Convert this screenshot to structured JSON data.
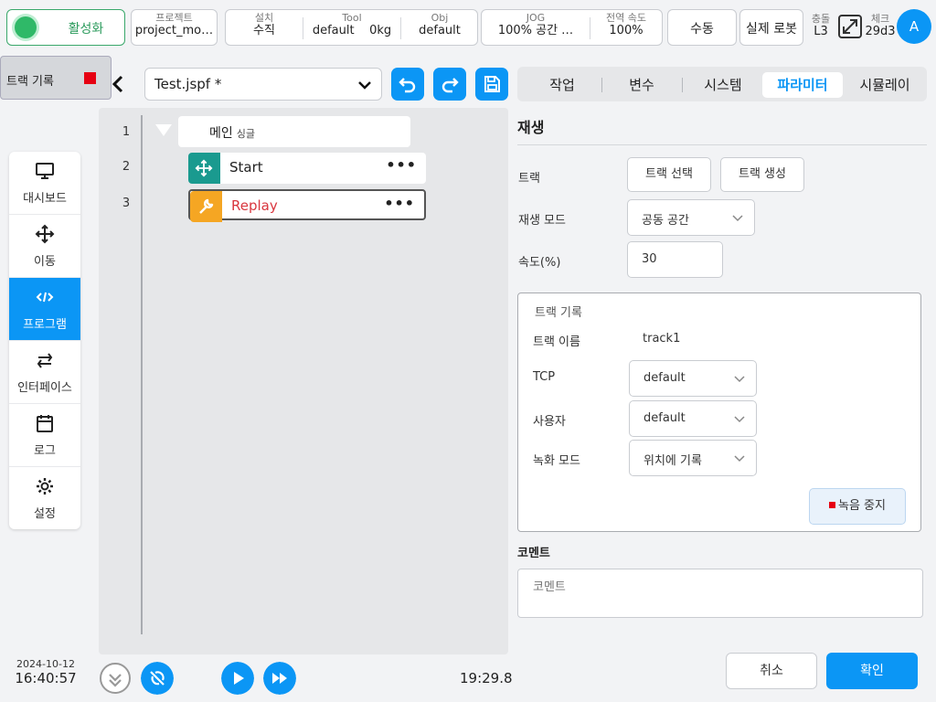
{
  "topbar": {
    "activate_label": "활성화",
    "project_caption": "프로젝트",
    "project_value": "project_mo…",
    "install_caption": "설치",
    "install_value": "수직",
    "tool_caption": "Tool",
    "tool_value": "default",
    "tool_weight": "0kg",
    "obj_caption": "Obj",
    "obj_value": "default",
    "jog_caption": "JOG",
    "jog_value": "100%  공간 …",
    "global_speed_caption": "전역 속도",
    "global_speed_value": "100%",
    "manual_label": "수동",
    "real_robot_label": "실제 로봇",
    "collision_caption": "충돌",
    "collision_value": "L3",
    "check_caption": "체크",
    "check_value": "29d3",
    "avatar_letter": "A"
  },
  "track_record_floating": {
    "label": "트랙 기록"
  },
  "sidebar": {
    "items": [
      {
        "label": "대시보드",
        "icon": "monitor-icon"
      },
      {
        "label": "이동",
        "icon": "move-icon"
      },
      {
        "label": "프로그램",
        "icon": "code-icon",
        "active": true
      },
      {
        "label": "인터페이스",
        "icon": "swap-icon"
      },
      {
        "label": "로그",
        "icon": "calendar-icon"
      },
      {
        "label": "설정",
        "icon": "gear-icon"
      }
    ]
  },
  "datetime": {
    "date": "2024-10-12",
    "time": "16:40:57"
  },
  "editor": {
    "file_name": "Test.jspf *",
    "lines": [
      "1",
      "2",
      "3"
    ],
    "main_label": "메인",
    "main_sub": "싱글",
    "nodes": [
      {
        "label": "Start",
        "icon": "move-icon",
        "color": "#1a9a8f"
      },
      {
        "label": "Replay",
        "icon": "wrench-icon",
        "color": "#f5a623",
        "selected": true
      }
    ],
    "more": "•••",
    "timer": "19:29.8"
  },
  "tabs": [
    {
      "label": "작업"
    },
    {
      "label": "변수"
    },
    {
      "label": "시스템"
    },
    {
      "label": "파라미터",
      "active": true
    },
    {
      "label": "시뮬레이"
    }
  ],
  "panel": {
    "title": "재생",
    "track_label": "트랙",
    "track_select_btn": "트랙 선택",
    "track_create_btn": "트랙 생성",
    "play_mode_label": "재생 모드",
    "play_mode_value": "공동 공간",
    "speed_label": "속도(%)",
    "speed_value": "30",
    "group": {
      "title": "트랙 기록",
      "track_name_label": "트랙 이름",
      "track_name_value": "track1",
      "tcp_label": "TCP",
      "tcp_value": "default",
      "user_label": "사용자",
      "user_value": "default",
      "record_mode_label": "녹화 모드",
      "record_mode_value": "위치에 기록",
      "stop_record_btn": "녹음 중지"
    },
    "comment_title": "코멘트",
    "comment_placeholder": "코멘트",
    "cancel_btn": "취소",
    "confirm_btn": "확인"
  },
  "colors": {
    "accent": "#0b96f5",
    "active_green": "#2fb968",
    "stop_red": "#e60012"
  }
}
